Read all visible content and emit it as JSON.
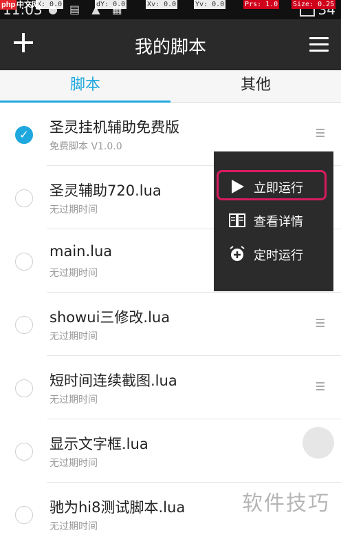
{
  "status_bar": {
    "time": "11:03",
    "battery": "34",
    "debug": [
      "X: 0.0",
      "dY: 0.0",
      "Xv: 0.0",
      "Yv: 0.0",
      "Prs: 1.0",
      "Size: 0.25"
    ]
  },
  "watermark_site": {
    "logo": "php",
    "site": "中文网"
  },
  "appbar": {
    "title": "我的脚本"
  },
  "tabs": [
    "脚本",
    "其他"
  ],
  "scripts": [
    {
      "name": "圣灵挂机辅助免费版",
      "sub": "免费脚本  V1.0.0",
      "checked": true
    },
    {
      "name": "圣灵辅助720.lua",
      "sub": "无过期时间",
      "checked": false
    },
    {
      "name": "main.lua",
      "sub": "无过期时间",
      "checked": false
    },
    {
      "name": "showui三修改.lua",
      "sub": "无过期时间",
      "checked": false
    },
    {
      "name": "短时间连续截图.lua",
      "sub": "无过期时间",
      "checked": false
    },
    {
      "name": "显示文字框.lua",
      "sub": "无过期时间",
      "checked": false
    },
    {
      "name": "驰为hi8测试脚本.lua",
      "sub": "无过期时间",
      "checked": false
    }
  ],
  "popup_menu": [
    {
      "label": "立即运行",
      "icon": "play-icon"
    },
    {
      "label": "查看详情",
      "icon": "book-icon"
    },
    {
      "label": "定时运行",
      "icon": "alarm-clock-icon"
    }
  ],
  "colors": {
    "accent": "#1fa8de",
    "highlight": "#d81b60",
    "appbar": "#2a2a2a"
  },
  "overlay_watermark": "软件技巧"
}
